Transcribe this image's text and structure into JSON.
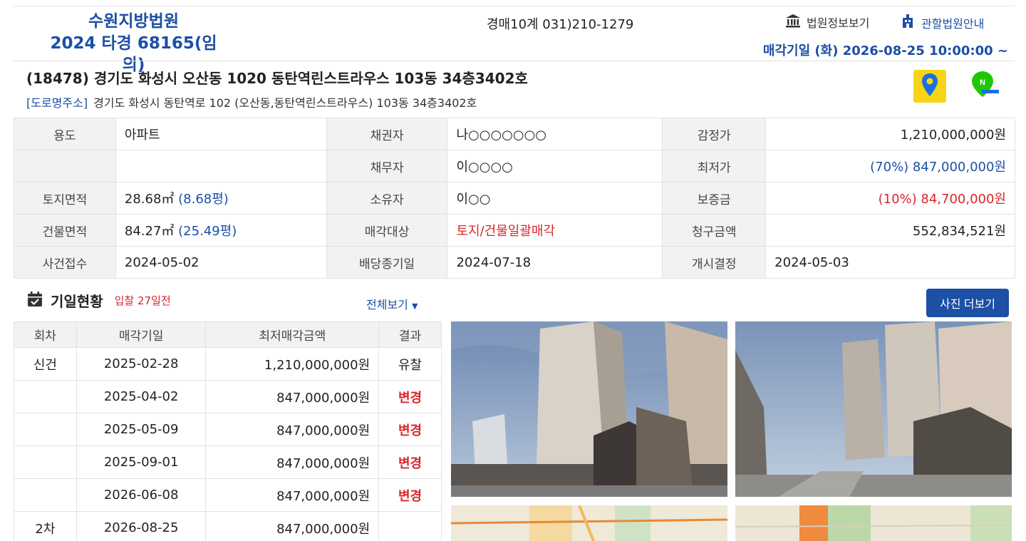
{
  "header": {
    "court_name": "수원지방법원",
    "case_number": "2024 타경 68165(임의)",
    "department": "경매10계 031)210-1279",
    "court_info_link": "법원정보보기",
    "jurisdiction_link": "관할법원안내",
    "sale_date": "매각기일  (화) 2026-08-25 10:00:00 ~"
  },
  "property": {
    "address": "(18478) 경기도 화성시 오산동 1020 동탄역린스트라우스 103동 34층3402호",
    "road_tag": "[도로명주소]",
    "road_address": "경기도 화성시 동탄역로 102 (오산동,동탄역린스트라우스) 103동 34층3402호"
  },
  "info": {
    "use_label": "용도",
    "use_value": "아파트",
    "creditor_label": "채권자",
    "creditor_value": "나○○○○○○○",
    "appraisal_label": "감정가",
    "appraisal_value": "1,210,000,000원",
    "debtor_label": "채무자",
    "debtor_value": "이○○○○",
    "min_label": "최저가",
    "min_value": "(70%) 847,000,000원",
    "land_label": "토지면적",
    "land_value": "28.68㎡",
    "land_pyeong": "(8.68평)",
    "owner_label": "소유자",
    "owner_value": "이○○",
    "deposit_label": "보증금",
    "deposit_value": "(10%) 84,700,000원",
    "building_label": "건물면적",
    "building_value": "84.27㎡",
    "building_pyeong": "(25.49평)",
    "target_label": "매각대상",
    "target_value": "토지/건물일괄매각",
    "claim_label": "청구금액",
    "claim_value": "552,834,521원",
    "received_label": "사건접수",
    "received_value": "2024-05-02",
    "dividend_label": "배당종기일",
    "dividend_value": "2024-07-18",
    "start_label": "개시결정",
    "start_value": "2024-05-03"
  },
  "schedule": {
    "title": "기일현황",
    "subtitle": "입찰 27일전",
    "view_all": "전체보기",
    "photo_more": "사진 더보기",
    "headers": [
      "회차",
      "매각기일",
      "최저매각금액",
      "결과"
    ],
    "rows": [
      {
        "round": "신건",
        "date": "2025-02-28",
        "price": "1,210,000,000원",
        "result": "유찰"
      },
      {
        "round": "",
        "date": "2025-04-02",
        "price": "847,000,000원",
        "result": "변경"
      },
      {
        "round": "",
        "date": "2025-05-09",
        "price": "847,000,000원",
        "result": "변경"
      },
      {
        "round": "",
        "date": "2025-09-01",
        "price": "847,000,000원",
        "result": "변경"
      },
      {
        "round": "",
        "date": "2026-06-08",
        "price": "847,000,000원",
        "result": "변경"
      },
      {
        "round": "2차",
        "date": "2026-08-25",
        "price": "847,000,000원",
        "result": ""
      }
    ]
  },
  "colors": {
    "accent": "#1c4fa5",
    "danger": "#d8262c",
    "label_bg": "#f2f2f2"
  }
}
